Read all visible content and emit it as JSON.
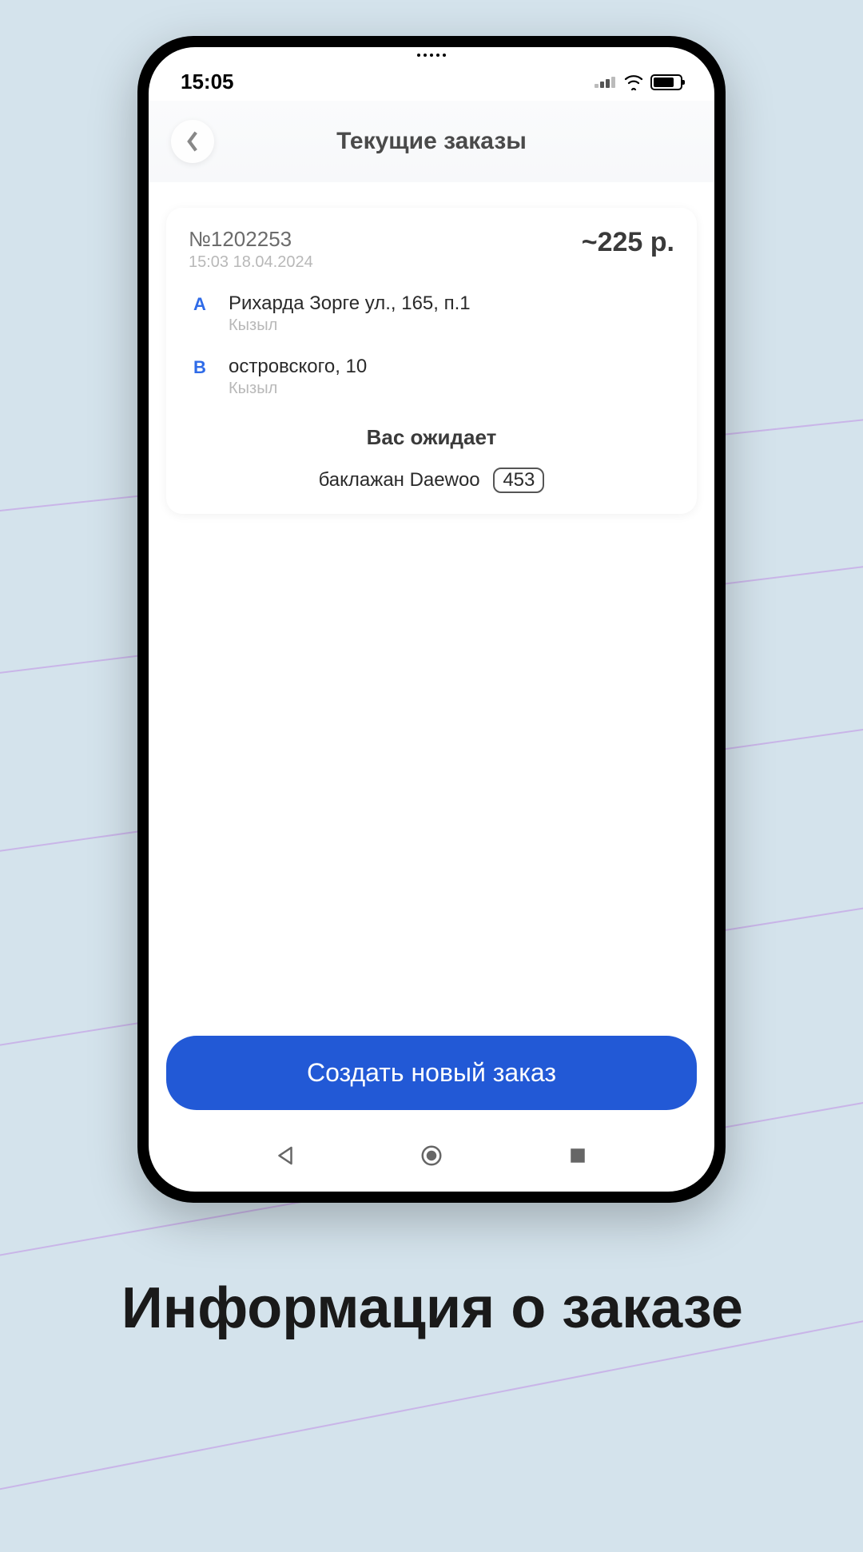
{
  "status_bar": {
    "time": "15:05"
  },
  "header": {
    "title": "Текущие заказы"
  },
  "order": {
    "number_label": "№1202253",
    "timestamp": "15:03 18.04.2024",
    "price": "~225 р.",
    "points": [
      {
        "letter": "A",
        "address": "Рихарда Зорге ул., 165, п.1",
        "city": "Кызыл"
      },
      {
        "letter": "B",
        "address": "островского, 10",
        "city": "Кызыл"
      }
    ],
    "waiting_label": "Вас ожидает",
    "vehicle_desc": "баклажан Daewoo",
    "vehicle_plate": "453"
  },
  "primary_button": "Создать новый заказ",
  "caption": "Информация о заказе"
}
